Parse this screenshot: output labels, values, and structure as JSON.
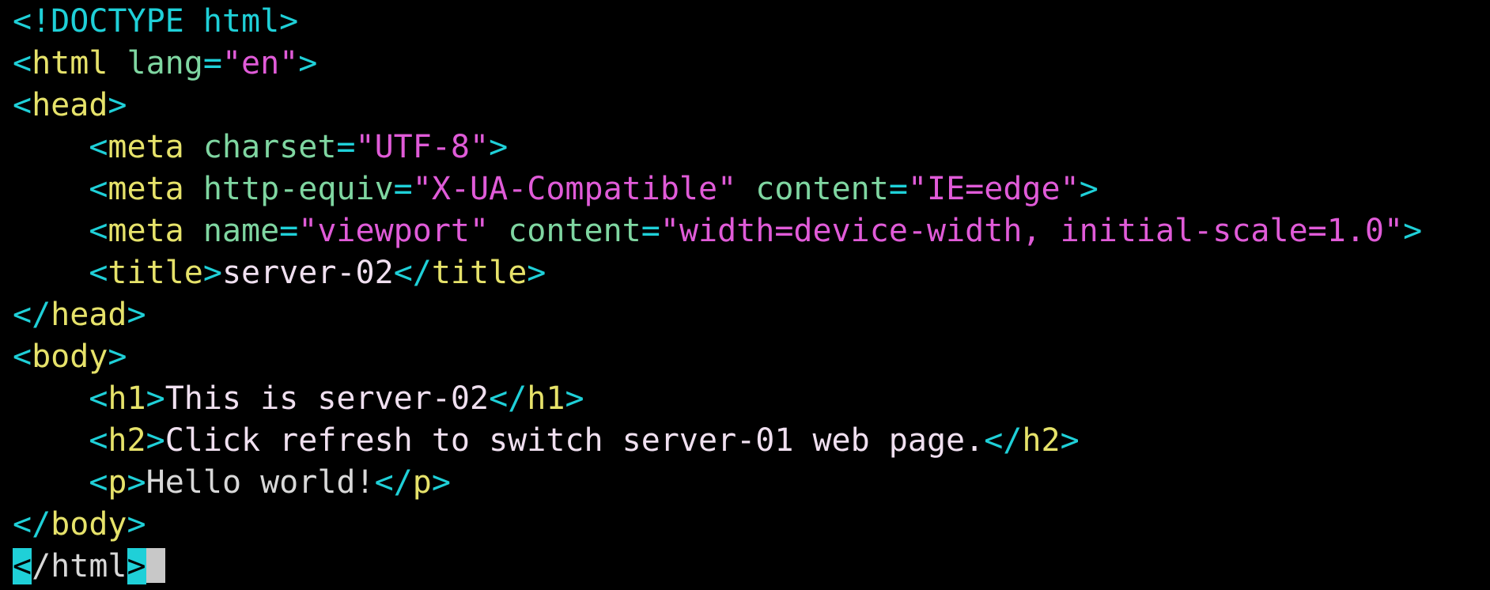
{
  "colors": {
    "background": "#000000",
    "bracket": "#1fd0d8",
    "tag": "#e6e26a",
    "attr": "#7fd6a1",
    "string": "#e05bd8",
    "text": "#f0e0f0",
    "plain": "#d8d8d8",
    "cursor": "#c8c8c8"
  },
  "editor": {
    "lines": [
      {
        "tokens": [
          {
            "t": "<!DOCTYPE html>",
            "c": "bracket"
          }
        ]
      },
      {
        "tokens": [
          {
            "t": "<",
            "c": "bracket"
          },
          {
            "t": "html",
            "c": "tag"
          },
          {
            "t": " ",
            "c": "plain"
          },
          {
            "t": "lang",
            "c": "attr"
          },
          {
            "t": "=",
            "c": "bracket"
          },
          {
            "t": "\"en\"",
            "c": "string"
          },
          {
            "t": ">",
            "c": "bracket"
          }
        ]
      },
      {
        "tokens": [
          {
            "t": "<",
            "c": "bracket"
          },
          {
            "t": "head",
            "c": "tag"
          },
          {
            "t": ">",
            "c": "bracket"
          }
        ]
      },
      {
        "tokens": [
          {
            "t": "    ",
            "c": "plain"
          },
          {
            "t": "<",
            "c": "bracket"
          },
          {
            "t": "meta",
            "c": "tag"
          },
          {
            "t": " ",
            "c": "plain"
          },
          {
            "t": "charset",
            "c": "attr"
          },
          {
            "t": "=",
            "c": "bracket"
          },
          {
            "t": "\"UTF-8\"",
            "c": "string"
          },
          {
            "t": ">",
            "c": "bracket"
          }
        ]
      },
      {
        "tokens": [
          {
            "t": "    ",
            "c": "plain"
          },
          {
            "t": "<",
            "c": "bracket"
          },
          {
            "t": "meta",
            "c": "tag"
          },
          {
            "t": " ",
            "c": "plain"
          },
          {
            "t": "http-equiv",
            "c": "attr"
          },
          {
            "t": "=",
            "c": "bracket"
          },
          {
            "t": "\"X-UA-Compatible\"",
            "c": "string"
          },
          {
            "t": " ",
            "c": "plain"
          },
          {
            "t": "content",
            "c": "attr"
          },
          {
            "t": "=",
            "c": "bracket"
          },
          {
            "t": "\"IE=edge\"",
            "c": "string"
          },
          {
            "t": ">",
            "c": "bracket"
          }
        ]
      },
      {
        "tokens": [
          {
            "t": "    ",
            "c": "plain"
          },
          {
            "t": "<",
            "c": "bracket"
          },
          {
            "t": "meta",
            "c": "tag"
          },
          {
            "t": " ",
            "c": "plain"
          },
          {
            "t": "name",
            "c": "attr"
          },
          {
            "t": "=",
            "c": "bracket"
          },
          {
            "t": "\"viewport\"",
            "c": "string"
          },
          {
            "t": " ",
            "c": "plain"
          },
          {
            "t": "content",
            "c": "attr"
          },
          {
            "t": "=",
            "c": "bracket"
          },
          {
            "t": "\"width=device-width, initial-scale=1.0\"",
            "c": "string"
          },
          {
            "t": ">",
            "c": "bracket"
          }
        ]
      },
      {
        "tokens": [
          {
            "t": "    ",
            "c": "plain"
          },
          {
            "t": "<",
            "c": "bracket"
          },
          {
            "t": "title",
            "c": "tag"
          },
          {
            "t": ">",
            "c": "bracket"
          },
          {
            "t": "server-02",
            "c": "text"
          },
          {
            "t": "</",
            "c": "bracket"
          },
          {
            "t": "title",
            "c": "tag"
          },
          {
            "t": ">",
            "c": "bracket"
          }
        ]
      },
      {
        "tokens": [
          {
            "t": "</",
            "c": "bracket"
          },
          {
            "t": "head",
            "c": "tag"
          },
          {
            "t": ">",
            "c": "bracket"
          }
        ]
      },
      {
        "tokens": [
          {
            "t": "<",
            "c": "bracket"
          },
          {
            "t": "body",
            "c": "tag"
          },
          {
            "t": ">",
            "c": "bracket"
          }
        ]
      },
      {
        "tokens": [
          {
            "t": "    ",
            "c": "plain"
          },
          {
            "t": "<",
            "c": "bracket"
          },
          {
            "t": "h1",
            "c": "tag"
          },
          {
            "t": ">",
            "c": "bracket"
          },
          {
            "t": "This is server-02",
            "c": "text"
          },
          {
            "t": "</",
            "c": "bracket"
          },
          {
            "t": "h1",
            "c": "tag"
          },
          {
            "t": ">",
            "c": "bracket"
          }
        ]
      },
      {
        "tokens": [
          {
            "t": "    ",
            "c": "plain"
          },
          {
            "t": "<",
            "c": "bracket"
          },
          {
            "t": "h2",
            "c": "tag"
          },
          {
            "t": ">",
            "c": "bracket"
          },
          {
            "t": "Click refresh to switch server-01 web page.",
            "c": "text"
          },
          {
            "t": "</",
            "c": "bracket"
          },
          {
            "t": "h2",
            "c": "tag"
          },
          {
            "t": ">",
            "c": "bracket"
          }
        ]
      },
      {
        "tokens": [
          {
            "t": "    ",
            "c": "plain"
          },
          {
            "t": "<",
            "c": "bracket"
          },
          {
            "t": "p",
            "c": "tag"
          },
          {
            "t": ">",
            "c": "bracket"
          },
          {
            "t": "Hello world!",
            "c": "plain"
          },
          {
            "t": "</",
            "c": "bracket"
          },
          {
            "t": "p",
            "c": "tag"
          },
          {
            "t": ">",
            "c": "bracket"
          }
        ]
      },
      {
        "tokens": [
          {
            "t": "</",
            "c": "bracket"
          },
          {
            "t": "body",
            "c": "tag"
          },
          {
            "t": ">",
            "c": "bracket"
          }
        ]
      },
      {
        "tokens": [
          {
            "t": "<",
            "c": "match"
          },
          {
            "t": "/html",
            "c": "plain"
          },
          {
            "t": ">",
            "c": "match"
          },
          {
            "t": "",
            "c": "cursor"
          }
        ]
      }
    ]
  }
}
